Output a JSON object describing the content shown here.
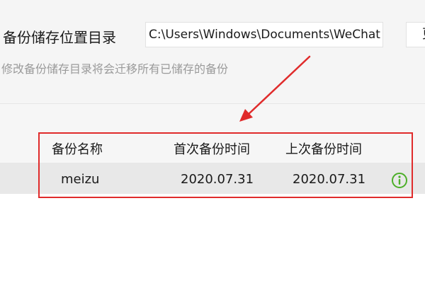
{
  "backup": {
    "location_label": "备份储存位置目录",
    "path_value": "C:\\Users\\Windows\\Documents\\WeChat Files",
    "change_button_label": "更改",
    "hint": "修改备份储存目录将会迁移所有已储存的备份"
  },
  "table": {
    "columns": [
      "备份名称",
      "首次备份时间",
      "上次备份时间"
    ],
    "rows": [
      {
        "name": "meizu",
        "first_backup": "2020.07.31",
        "last_backup": "2020.07.31",
        "icon": "info-icon"
      }
    ]
  },
  "colors": {
    "annotation": "#e02b2b",
    "info_icon": "#4caf28"
  }
}
